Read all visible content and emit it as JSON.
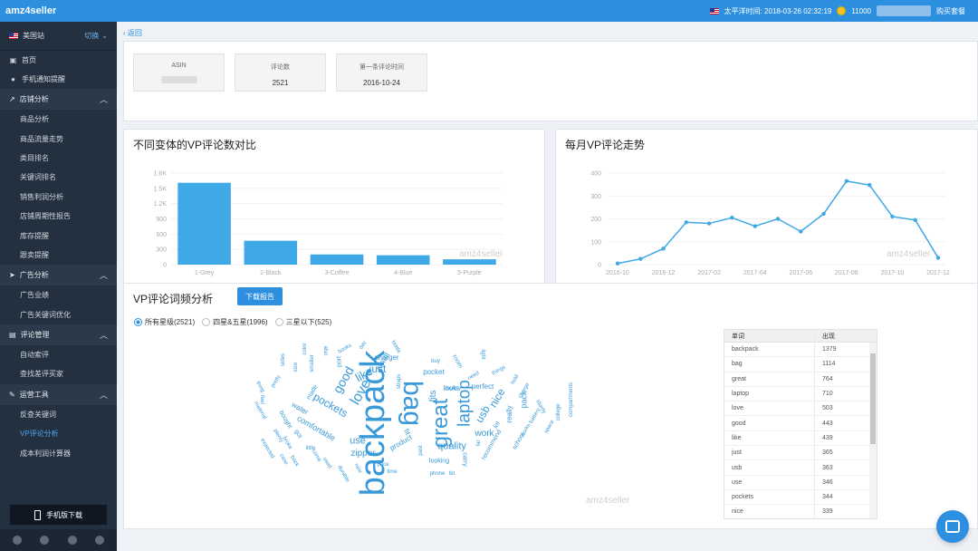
{
  "topbar": {
    "brand": "amz4seller",
    "timezone_label": "太平洋时间: 2018-03-26 02:32:19",
    "coins": "11000",
    "buy_label": "购买套餐"
  },
  "sidebar": {
    "site": "美国站",
    "switch_label": "切换",
    "home": "首页",
    "mobile_notice": "手机通知提醒",
    "groups": [
      {
        "label": "店铺分析",
        "items": [
          "商品分析",
          "商品流量走势",
          "类目排名",
          "关键词排名",
          "销售利润分析",
          "店铺周期性报告",
          "库存提醒",
          "跟卖提醒"
        ]
      },
      {
        "label": "广告分析",
        "items": [
          "广告业绩",
          "广告关键词优化"
        ]
      },
      {
        "label": "评论管理",
        "items": [
          "自动索评",
          "查找差评买家"
        ]
      },
      {
        "label": "运营工具",
        "items": [
          "反查关键词",
          "VP评论分析",
          "成本利润计算器"
        ]
      }
    ],
    "mobile_download": "手机版下载"
  },
  "main": {
    "back": "返回",
    "info": [
      {
        "label": "ASIN",
        "value": ""
      },
      {
        "label": "评论数",
        "value": "2521"
      },
      {
        "label": "第一条评论时间",
        "value": "2016-10-24"
      }
    ],
    "freq_title": "VP评论词频分析",
    "download_label": "下载报告",
    "radios": [
      "所有星级(2521)",
      "四星&五星(1996)",
      "三星以下(525)"
    ],
    "table_headers": [
      "单词",
      "出现"
    ],
    "table_rows": [
      [
        "backpack",
        "1379"
      ],
      [
        "bag",
        "1114"
      ],
      [
        "great",
        "764"
      ],
      [
        "laptop",
        "710"
      ],
      [
        "love",
        "503"
      ],
      [
        "good",
        "443"
      ],
      [
        "like",
        "439"
      ],
      [
        "just",
        "365"
      ],
      [
        "usb",
        "363"
      ],
      [
        "use",
        "346"
      ],
      [
        "pockets",
        "344"
      ],
      [
        "nice",
        "339"
      ]
    ],
    "watermark": "amz4seller"
  },
  "chart_data": [
    {
      "type": "bar",
      "title": "不同变体的VP评论数对比",
      "categories": [
        "1-Grey",
        "2-Black",
        "3-Coffee",
        "4-Blue",
        "5-Purple"
      ],
      "values": [
        1610,
        470,
        200,
        185,
        105
      ],
      "ylim": [
        0,
        1800
      ],
      "yticks": [
        "0",
        "300",
        "600",
        "900",
        "1.2K",
        "1.5K",
        "1.8K"
      ],
      "color": "#3fa8e6",
      "grid": true
    },
    {
      "type": "line",
      "title": "每月VP评论走势",
      "x": [
        "2016-10",
        "2016-11",
        "2016-12",
        "2017-01",
        "2017-02",
        "2017-03",
        "2017-04",
        "2017-05",
        "2017-06",
        "2017-07",
        "2017-08",
        "2017-09",
        "2017-10",
        "2017-11",
        "2017-12"
      ],
      "values": [
        5,
        25,
        70,
        185,
        180,
        205,
        168,
        200,
        145,
        222,
        365,
        348,
        210,
        195,
        30
      ],
      "xticks": [
        "2016-10",
        "2016-12",
        "2017-02",
        "2017-04",
        "2017-06",
        "2017-08",
        "2017-10",
        "2017-12"
      ],
      "ylim": [
        0,
        400
      ],
      "yticks": [
        "0",
        "100",
        "200",
        "300",
        "400"
      ],
      "color": "#3fa8e6",
      "grid": true
    }
  ],
  "wordcloud": [
    {
      "w": "backpack",
      "s": 38,
      "r": -90
    },
    {
      "w": "bag",
      "s": 30,
      "r": 90
    },
    {
      "w": "great",
      "s": 24,
      "r": -90
    },
    {
      "w": "laptop",
      "s": 19,
      "r": -90
    },
    {
      "w": "love",
      "s": 16,
      "r": -60
    },
    {
      "w": "good",
      "s": 14,
      "r": -60
    },
    {
      "w": "like",
      "s": 13,
      "r": -30
    },
    {
      "w": "just",
      "s": 12,
      "r": 0
    },
    {
      "w": "usb",
      "s": 12,
      "r": -60
    },
    {
      "w": "use",
      "s": 11,
      "r": 0
    },
    {
      "w": "pockets",
      "s": 12,
      "r": 30
    },
    {
      "w": "nice",
      "s": 12,
      "r": -60
    },
    {
      "w": "quality",
      "s": 11,
      "r": 0
    },
    {
      "w": "work",
      "s": 10,
      "r": 0
    },
    {
      "w": "fits",
      "s": 10,
      "r": -90
    },
    {
      "w": "comfortable",
      "s": 9,
      "r": 30
    },
    {
      "w": "zipper",
      "s": 10,
      "r": 0
    },
    {
      "w": "small",
      "s": 9,
      "r": -60
    },
    {
      "w": "charger",
      "s": 8,
      "r": 0
    },
    {
      "w": "perfect",
      "s": 8,
      "r": 0
    },
    {
      "w": "really",
      "s": 8,
      "r": -90
    },
    {
      "w": "pack",
      "s": 9,
      "r": -90
    },
    {
      "w": "pocket",
      "s": 8,
      "r": 0
    },
    {
      "w": "looks",
      "s": 8,
      "r": 0
    },
    {
      "w": "product",
      "s": 8,
      "r": -30
    },
    {
      "w": "fit",
      "s": 8,
      "r": 60
    },
    {
      "w": "water",
      "s": 8,
      "r": 30
    },
    {
      "w": "made",
      "s": 7,
      "r": -60
    },
    {
      "w": "room",
      "s": 7,
      "r": 60
    },
    {
      "w": "port",
      "s": 7,
      "r": -90
    },
    {
      "w": "carry",
      "s": 7,
      "r": 90
    },
    {
      "w": "lot",
      "s": 7,
      "r": -60
    },
    {
      "w": "looking",
      "s": 7,
      "r": 0
    },
    {
      "w": "recommend",
      "s": 7,
      "r": -60
    },
    {
      "w": "school",
      "s": 7,
      "r": -60
    },
    {
      "w": "books",
      "s": 6,
      "r": -30
    },
    {
      "w": "buy",
      "s": 6,
      "r": 0
    },
    {
      "w": "bought",
      "s": 7,
      "r": 60
    },
    {
      "w": "got",
      "s": 7,
      "r": 60
    },
    {
      "w": "price",
      "s": 6,
      "r": 0
    },
    {
      "w": "time",
      "s": 6,
      "r": 0
    },
    {
      "w": "phone",
      "s": 6,
      "r": 0
    },
    {
      "w": "need",
      "s": 6,
      "r": -30
    },
    {
      "w": "light",
      "s": 6,
      "r": 90
    },
    {
      "w": "things",
      "s": 6,
      "r": -30
    },
    {
      "w": "hold",
      "s": 6,
      "r": -60
    },
    {
      "w": "charge",
      "s": 6,
      "r": -60
    },
    {
      "w": "battery",
      "s": 6,
      "r": -60
    },
    {
      "w": "sturdy",
      "s": 6,
      "r": 60
    },
    {
      "w": "space",
      "s": 6,
      "r": -60
    },
    {
      "w": "works",
      "s": 6,
      "r": -60
    },
    {
      "w": "college",
      "s": 6,
      "r": -90
    },
    {
      "w": "compartments",
      "s": 6,
      "r": -90
    },
    {
      "w": "also",
      "s": 6,
      "r": 90
    },
    {
      "w": "straps",
      "s": 6,
      "r": -90
    },
    {
      "w": "far",
      "s": 6,
      "r": -90
    },
    {
      "w": "bit",
      "s": 6,
      "r": 0
    },
    {
      "w": "new",
      "s": 6,
      "r": 60
    },
    {
      "w": "durable",
      "s": 6,
      "r": 60
    },
    {
      "w": "little",
      "s": 6,
      "r": 0
    },
    {
      "w": "back",
      "s": 6,
      "r": 60
    },
    {
      "w": "looks",
      "s": 6,
      "r": 0
    },
    {
      "w": "plenty",
      "s": 6,
      "r": 60
    },
    {
      "w": "broke",
      "s": 6,
      "r": 60
    },
    {
      "w": "material",
      "s": 6,
      "r": 60
    },
    {
      "w": "expected",
      "s": 6,
      "r": 60
    },
    {
      "w": "smaller",
      "s": 6,
      "r": -90
    },
    {
      "w": "thing",
      "s": 6,
      "r": 60
    },
    {
      "w": "pretty",
      "s": 6,
      "r": -60
    },
    {
      "w": "size",
      "s": 6,
      "r": -90
    },
    {
      "w": "color",
      "s": 6,
      "r": -90
    },
    {
      "w": "sides",
      "s": 6,
      "r": -90
    },
    {
      "w": "day",
      "s": 6,
      "r": -60
    },
    {
      "w": "bottle",
      "s": 6,
      "r": 60
    },
    {
      "w": "used",
      "s": 6,
      "r": 60
    },
    {
      "w": "come",
      "s": 6,
      "r": 60
    },
    {
      "w": "case",
      "s": 6,
      "r": 60
    },
    {
      "w": "past",
      "s": 6,
      "r": -90
    },
    {
      "w": "feel",
      "s": 6,
      "r": 90
    }
  ]
}
